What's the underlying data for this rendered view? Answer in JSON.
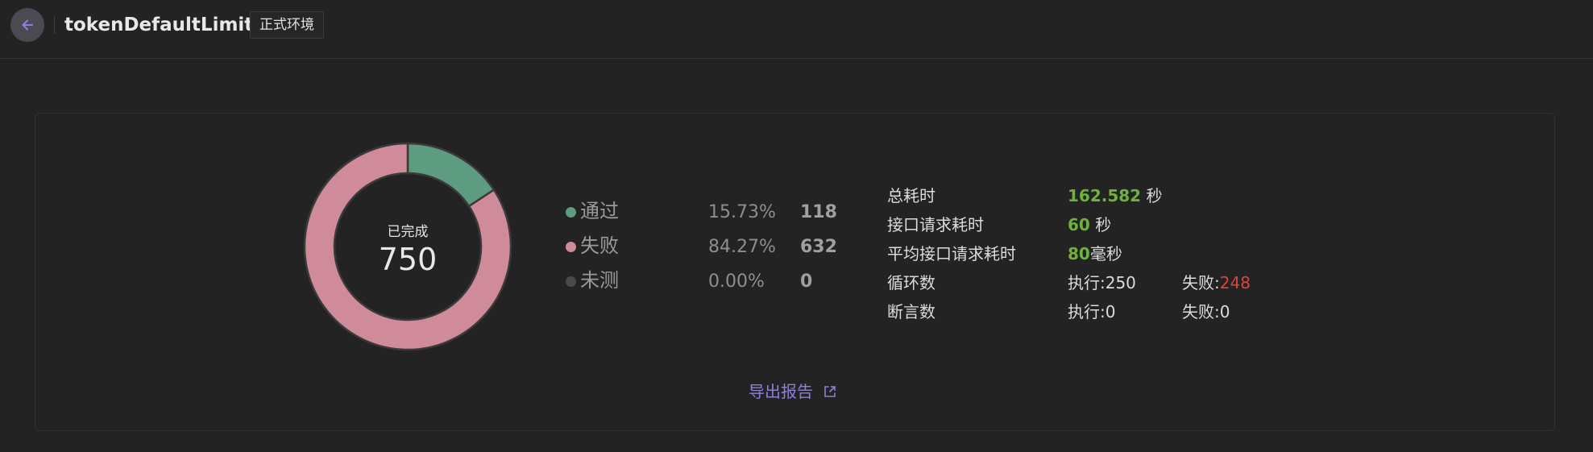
{
  "header": {
    "title": "tokenDefaultLimiter",
    "env_badge": "正式环境"
  },
  "summary": {
    "center_label": "已完成",
    "total": "750",
    "legend": [
      {
        "label": "通过",
        "percent": "15.73%",
        "count": "118",
        "color": "#5e9c81"
      },
      {
        "label": "失败",
        "percent": "84.27%",
        "count": "632",
        "color": "#d08b9a"
      },
      {
        "label": "未测",
        "percent": "0.00%",
        "count": "0",
        "color": "#4a4a4a"
      }
    ]
  },
  "chart_data": {
    "type": "pie",
    "categories": [
      "通过",
      "失败",
      "未测"
    ],
    "values": [
      118,
      632,
      0
    ],
    "center_label": "已完成",
    "center_value": 750
  },
  "stats": {
    "total_time_label": "总耗时",
    "total_time_value": "162.582",
    "total_time_unit": " 秒",
    "req_time_label": "接口请求耗时",
    "req_time_value": "60",
    "req_time_unit": " 秒",
    "avg_req_label": "平均接口请求耗时",
    "avg_req_value": "80",
    "avg_req_unit": "毫秒",
    "loop_label": "循环数",
    "loop_exec": "执行:250",
    "loop_fail_prefix": "失败:",
    "loop_fail_value": "248",
    "assert_label": "断言数",
    "assert_exec": "执行:0",
    "assert_fail_prefix": "失败:",
    "assert_fail_value": "0"
  },
  "actions": {
    "export_label": "导出报告"
  },
  "icons": {
    "back": "arrow-left-icon",
    "export": "external-link-icon"
  }
}
